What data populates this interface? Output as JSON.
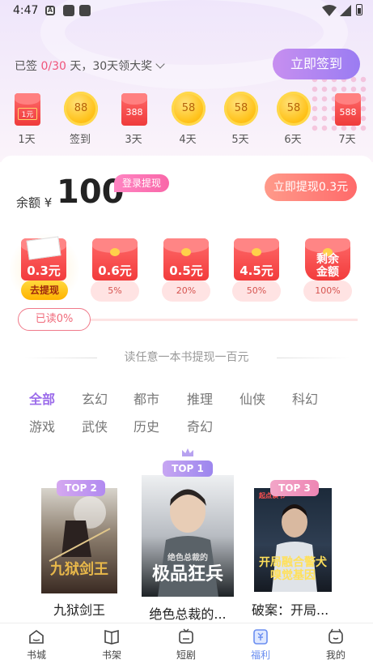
{
  "status_bar": {
    "time": "4:47",
    "notif_a": "A"
  },
  "signin": {
    "prefix": "已签 ",
    "progress": "0/30",
    "suffix": " 天，30天领大奖",
    "button": "立即签到",
    "days": [
      {
        "kind": "redpack",
        "amount": "1元",
        "label": "1天"
      },
      {
        "kind": "coin",
        "amount": "88",
        "label": "签到"
      },
      {
        "kind": "redpack",
        "amount": "388",
        "label": "3天"
      },
      {
        "kind": "coin",
        "amount": "58",
        "label": "4天"
      },
      {
        "kind": "coin",
        "amount": "58",
        "label": "5天"
      },
      {
        "kind": "coin",
        "amount": "58",
        "label": "6天"
      },
      {
        "kind": "redpack",
        "amount": "588",
        "label": "7天"
      }
    ]
  },
  "balance": {
    "label": "余额",
    "currency": "¥",
    "value": "100",
    "login_badge": "登录提现",
    "withdraw_button": "立即提现0.3元"
  },
  "stages": [
    {
      "amount": "0.3元",
      "action": "去提现"
    },
    {
      "amount": "0.6元",
      "percent": "5%"
    },
    {
      "amount": "0.5元",
      "percent": "20%"
    },
    {
      "amount": "4.5元",
      "percent": "50%"
    },
    {
      "amount": "剩余金额",
      "percent": "100%"
    }
  ],
  "read_progress": {
    "label": "已读0%",
    "value": 0
  },
  "promo": "读任意一本书提现一百元",
  "categories": [
    "全部",
    "玄幻",
    "都市",
    "推理",
    "仙侠",
    "科幻",
    "游戏",
    "武侠",
    "历史",
    "奇幻"
  ],
  "active_category": "全部",
  "top_books": [
    {
      "rank": "TOP 2",
      "title": "九狱剑王",
      "cover_text": "九狱剑王"
    },
    {
      "rank": "TOP 1",
      "title": "绝色总裁的...",
      "cover_text": "极品狂兵",
      "cover_subtext": "绝色总裁的"
    },
    {
      "rank": "TOP 3",
      "title": "破案：开局...",
      "cover_text": "开局融合警犬 嗅觉基因",
      "cover_subtext": "起点读书"
    }
  ],
  "bottom_nav": [
    {
      "label": "书城",
      "icon": "bookstore-icon"
    },
    {
      "label": "书架",
      "icon": "bookshelf-icon"
    },
    {
      "label": "短剧",
      "icon": "short-drama-icon"
    },
    {
      "label": "福利",
      "icon": "welfare-icon",
      "active": true
    },
    {
      "label": "我的",
      "icon": "profile-icon"
    }
  ],
  "colors": {
    "accent_purple": "#9b6bea",
    "signin_gradient_start": "#c78ff0",
    "signin_gradient_end": "#9a7cf2",
    "red": "#ef3b3b",
    "nav_active": "#6a8ef0"
  }
}
